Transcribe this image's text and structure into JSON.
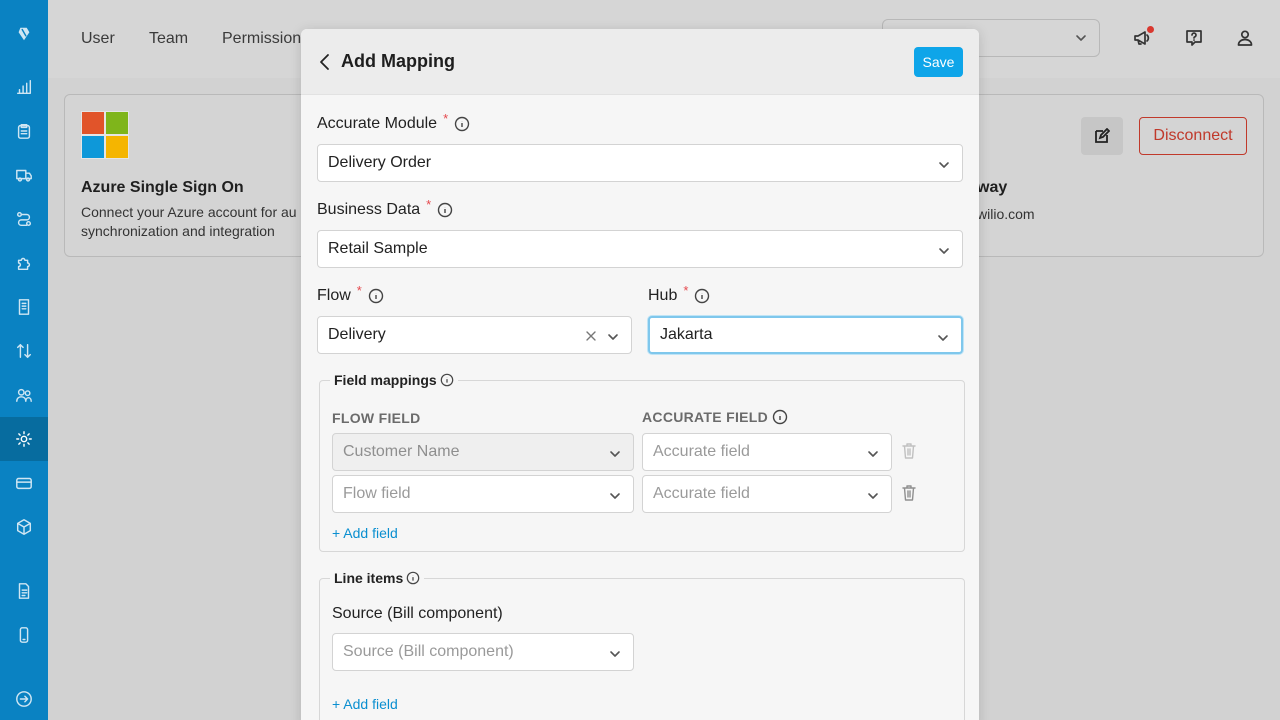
{
  "topbar": {
    "tabs": [
      "User",
      "Team",
      "Permission"
    ],
    "icons": [
      "megaphone-icon",
      "help-icon",
      "user-icon"
    ]
  },
  "sidebar": {
    "icons": [
      "logo-icon",
      "chart-icon",
      "clipboard-icon",
      "truck-icon",
      "route-icon",
      "puzzle-icon",
      "receipt-icon",
      "exchange-icon",
      "users-icon",
      "settings-icon",
      "credit-card-icon",
      "box-icon",
      "document-icon",
      "mobile-icon",
      "logout-icon"
    ],
    "active": "settings-icon"
  },
  "background_card": {
    "title": "Azure Single Sign On",
    "description": "Connect your Azure account for au",
    "description2": "synchronization and integration",
    "right_title": "way",
    "right_desc": "wilio.com",
    "disconnect_label": "Disconnect"
  },
  "modal": {
    "title": "Add Mapping",
    "save_label": "Save",
    "accurate_module": {
      "label": "Accurate Module",
      "required": "*",
      "value": "Delivery Order"
    },
    "business_data": {
      "label": "Business Data",
      "required": "*",
      "value": "Retail Sample"
    },
    "flow": {
      "label": "Flow",
      "required": "*",
      "value": "Delivery"
    },
    "hub": {
      "label": "Hub",
      "required": "*",
      "value": "Jakarta"
    },
    "field_mappings": {
      "legend": "Field mappings",
      "flow_field_header": "FLOW FIELD",
      "accurate_field_header": "ACCURATE FIELD",
      "rows": [
        {
          "flow": "Customer Name",
          "accurate": "Accurate field"
        },
        {
          "flow": "Flow field",
          "accurate": "Accurate field"
        }
      ],
      "add_label": "+ Add field"
    },
    "line_items": {
      "legend": "Line items",
      "source_label": "Source (Bill component)",
      "source_placeholder": "Source (Bill component)",
      "add_label": "+ Add field"
    }
  },
  "colors": {
    "sidebar": "#0a82c2",
    "accent": "#0ea5e9",
    "danger": "#c0392b",
    "required": "#e5484d"
  }
}
